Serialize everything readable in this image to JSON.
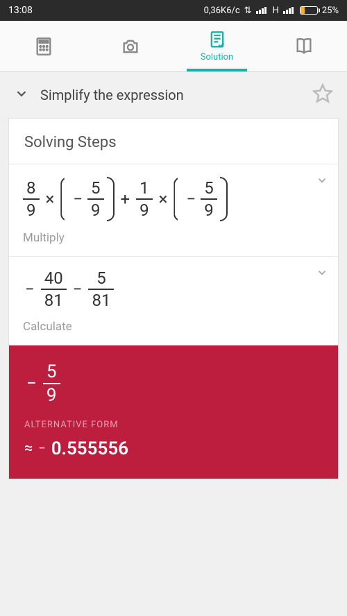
{
  "statusbar": {
    "time": "13:08",
    "speed": "0,36K6/c",
    "net_label": "H",
    "battery_pct": "25%"
  },
  "tabs": {
    "solution_label": "Solution"
  },
  "titlebar": {
    "title": "Simplify the expression"
  },
  "card": {
    "heading": "Solving Steps"
  },
  "step1": {
    "f1": {
      "n": "8",
      "d": "9"
    },
    "op1": "×",
    "p1_sign": "−",
    "p1": {
      "n": "5",
      "d": "9"
    },
    "op2": "+",
    "f3": {
      "n": "1",
      "d": "9"
    },
    "op3": "×",
    "p2_sign": "−",
    "p2": {
      "n": "5",
      "d": "9"
    },
    "label": "Multiply"
  },
  "step2": {
    "sign1": "−",
    "f1": {
      "n": "40",
      "d": "81"
    },
    "op": "−",
    "f2": {
      "n": "5",
      "d": "81"
    },
    "label": "Calculate"
  },
  "result": {
    "sign": "−",
    "f": {
      "n": "5",
      "d": "9"
    },
    "alt_title": "ALTERNATIVE FORM",
    "approx": "≈",
    "neg": "−",
    "value": "0.555556"
  }
}
